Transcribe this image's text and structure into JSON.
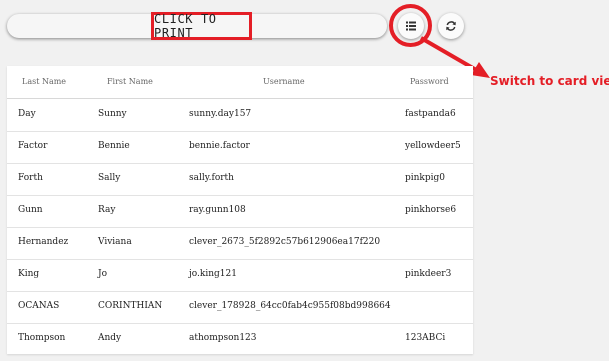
{
  "toolbar": {
    "print_label": "CLICK TO PRINT"
  },
  "annotation": {
    "callout_text": "Switch to card view",
    "color": "#e41e26"
  },
  "icons": {
    "list": "view-list-icon",
    "refresh": "refresh-icon"
  },
  "table": {
    "headers": [
      "Last Name",
      "First Name",
      "Username",
      "Password"
    ],
    "rows": [
      {
        "last": "Day",
        "first": "Sunny",
        "username": "sunny.day157",
        "password": "fastpanda6"
      },
      {
        "last": "Factor",
        "first": "Bennie",
        "username": "bennie.factor",
        "password": "yellowdeer5"
      },
      {
        "last": "Forth",
        "first": "Sally",
        "username": "sally.forth",
        "password": "pinkpig0"
      },
      {
        "last": "Gunn",
        "first": "Ray",
        "username": "ray.gunn108",
        "password": "pinkhorse6"
      },
      {
        "last": "Hernandez",
        "first": "Viviana",
        "username": "clever_2673_5f2892c57b612906ea17f220",
        "password": ""
      },
      {
        "last": "King",
        "first": "Jo",
        "username": "jo.king121",
        "password": "pinkdeer3"
      },
      {
        "last": "OCANAS",
        "first": "CORINTHIAN",
        "username": "clever_178928_64cc0fab4c955f08bd998664",
        "password": ""
      },
      {
        "last": "Thompson",
        "first": "Andy",
        "username": "athompson123",
        "password": "123ABCi"
      }
    ]
  }
}
